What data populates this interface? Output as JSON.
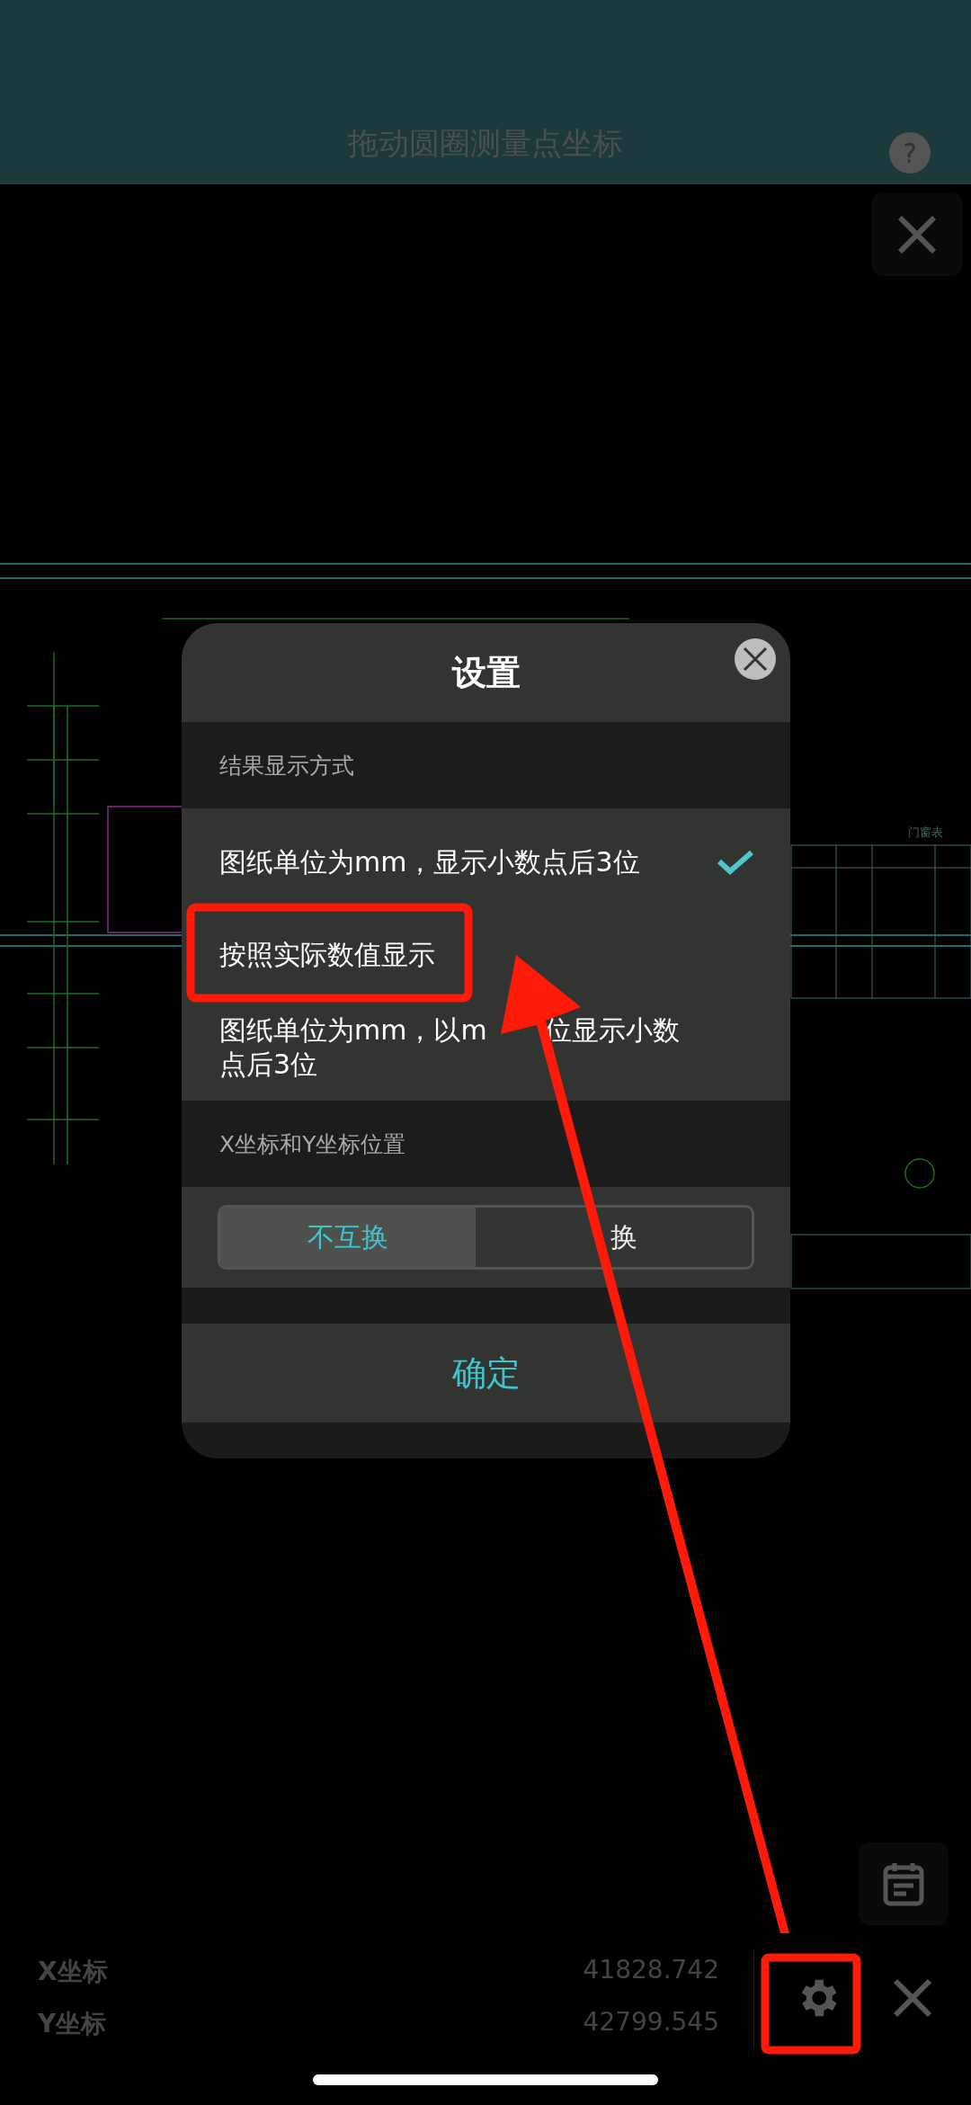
{
  "header": {
    "title": "拖动圆圈测量点坐标",
    "help_icon": "?"
  },
  "drawing": {
    "table_title": "门窗表"
  },
  "dialog": {
    "title": "设置",
    "sections": [
      {
        "heading": "结果显示方式",
        "kind": "list",
        "options": [
          {
            "label": "图纸单位为mm，显示小数点后3位",
            "selected": true
          },
          {
            "label": "按照实际数值显示",
            "selected": false
          },
          {
            "label_parts": [
              "图纸单位为mm，以m",
              "位显示小数点后3位"
            ],
            "selected": false
          }
        ]
      },
      {
        "heading": "X坐标和Y坐标位置",
        "kind": "segmented",
        "options": [
          {
            "label": "不互换",
            "selected": true
          },
          {
            "label": "换",
            "selected": false
          }
        ]
      }
    ],
    "confirm": "确定"
  },
  "coordinates": [
    {
      "label": "X坐标",
      "value": "41828.742"
    },
    {
      "label": "Y坐标",
      "value": "42799.545"
    }
  ]
}
